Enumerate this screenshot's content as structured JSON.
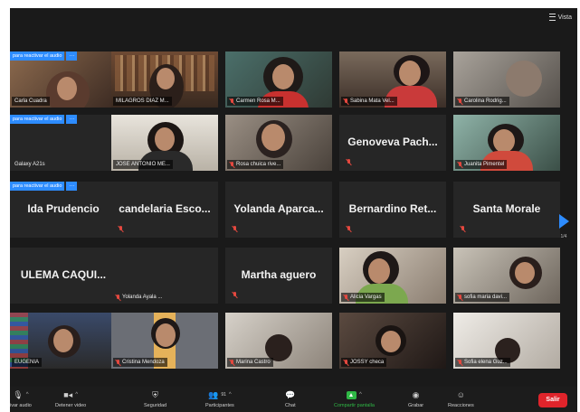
{
  "view_button": {
    "label": "Vista"
  },
  "unmute_request": {
    "text": "para reactivar el audio",
    "more": "···"
  },
  "tiles": [
    {
      "name": "Carla Cuadra"
    },
    {
      "name": "MILAGROS DIAZ M..."
    },
    {
      "name": "Carmen Rosa M..."
    },
    {
      "name": "Sabina Mata Vel..."
    },
    {
      "name": "Carolina Rodrig..."
    },
    {
      "name": "Galaxy A21s"
    },
    {
      "name": "JOSE ANTONIO ME..."
    },
    {
      "name": "Rosa chuica rive..."
    },
    {
      "name": "Genoveva Pach..."
    },
    {
      "name": "Juanita Pimentel"
    },
    {
      "name": "Ida Prudencio"
    },
    {
      "name": "candelaria Esco..."
    },
    {
      "name": "Yolanda Aparca..."
    },
    {
      "name": "Bernardino Ret..."
    },
    {
      "name": "Santa Morale"
    },
    {
      "name": "ULEMA CAQUI..."
    },
    {
      "name": "Yolanda Ayala ..."
    },
    {
      "name": "Martha aguero"
    },
    {
      "name": "Alicia Vargas"
    },
    {
      "name": "sofia maria davi..."
    },
    {
      "name": "EUGENIA"
    },
    {
      "name": "Cristina Mendoza"
    },
    {
      "name": "Marina Castro"
    },
    {
      "name": "JOSSY checa"
    },
    {
      "name": "Sofia elena Guz..."
    }
  ],
  "pagination": {
    "page": "1/4"
  },
  "toolbar": {
    "mute": "ivar audio",
    "stop_video": "Detener video",
    "security": "Seguridad",
    "participants": "Participantes",
    "participants_count": "91",
    "chat": "Chat",
    "share": "Compartir pantalla",
    "record": "Grabar",
    "reactions": "Reacciones",
    "leave": "Salir"
  },
  "colors": {
    "accent_blue": "#2d8cff",
    "share_green": "#2fb845",
    "leave_red": "#e0242b",
    "speaker_border": "#c9d23a",
    "muted_red": "#e5483f"
  }
}
